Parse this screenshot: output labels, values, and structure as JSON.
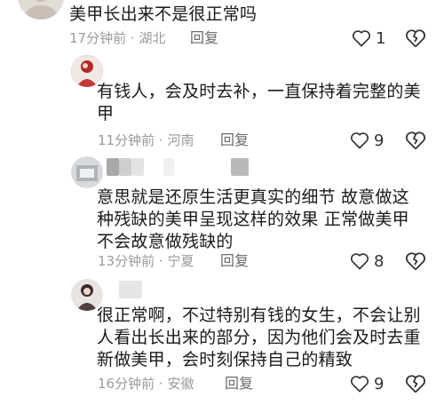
{
  "comments": [
    {
      "text": "美甲长出来不是很正常吗",
      "time": "17分钟前",
      "location": "湖北",
      "reply_label": "回复",
      "likes": "1"
    },
    {
      "text_line1": "有钱人，会及时去补，一直保持着完整的美",
      "text_line2": "甲",
      "time": "11分钟前",
      "location": "河南",
      "reply_label": "回复",
      "likes": "9"
    },
    {
      "text_line1": "意思就是还原生活更真实的细节 故意做这",
      "text_line2": "种残缺的美甲呈现这样的效果 正常做美甲",
      "text_line3": "不会故意做残缺的",
      "time": "13分钟前",
      "location": "宁夏",
      "reply_label": "回复",
      "likes": "8"
    },
    {
      "text_line1": "很正常啊，不过特别有钱的女生，不会让别",
      "text_line2": "人看出长出来的部分，因为他们会及时去重",
      "text_line3": "新做美甲，会时刻保持自己的精致",
      "time": "16分钟前",
      "location": "安徽",
      "reply_label": "回复",
      "likes": "9"
    }
  ],
  "separator": "·",
  "colors": {
    "meta": "#9a9a9a",
    "text": "#1a1a1a",
    "reply": "#6a6a6a"
  },
  "icons": [
    "avatar",
    "heart-outline-icon",
    "broken-heart-icon"
  ]
}
